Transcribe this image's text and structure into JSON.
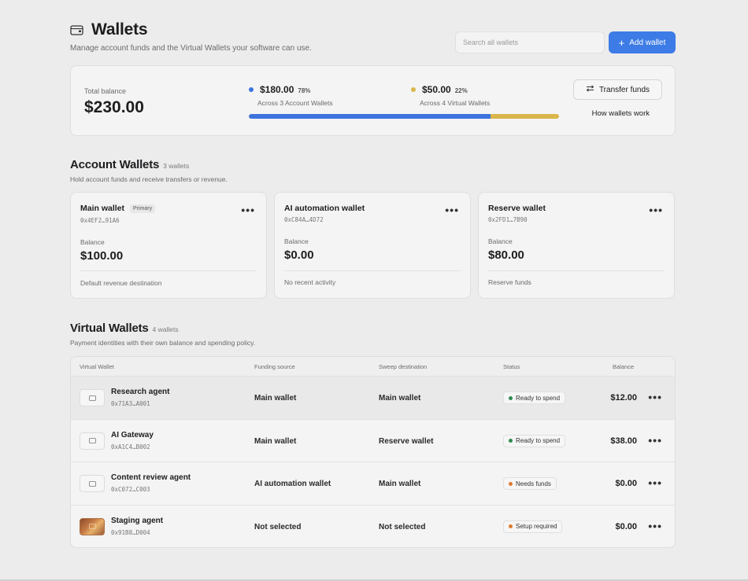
{
  "header": {
    "title": "Wallets",
    "subtitle": "Manage account funds and the Virtual Wallets your software can use.",
    "search_placeholder": "Search all wallets",
    "add_label": "Add wallet",
    "wallet_icon": "wallet-icon"
  },
  "balance": {
    "total_label": "Total balance",
    "total_value": "$230.00",
    "account": {
      "amount": "$180.00",
      "pct": "78%",
      "across": "Across 3 Account Wallets",
      "color": "#3d74de",
      "fraction": 0.78
    },
    "virtual": {
      "amount": "$50.00",
      "pct": "22%",
      "across": "Across 4 Virtual Wallets",
      "color": "#d9b64a",
      "fraction": 0.22
    },
    "transfer_label": "Transfer funds",
    "how_label": "How wallets work"
  },
  "account_wallets": {
    "title": "Account Wallets",
    "count": "3 wallets",
    "subtitle": "Hold account funds and receive transfers or revenue.",
    "balance_label": "Balance",
    "items": [
      {
        "name": "Main wallet",
        "badge": "Primary",
        "addr": "0x4EF2…91A6",
        "balance": "$100.00",
        "footer": "Default revenue destination"
      },
      {
        "name": "AI automation wallet",
        "badge": "",
        "addr": "0xC84A…4D72",
        "balance": "$0.00",
        "footer": "No recent activity"
      },
      {
        "name": "Reserve wallet",
        "badge": "",
        "addr": "0x2FD1…7B90",
        "balance": "$80.00",
        "footer": "Reserve funds"
      }
    ]
  },
  "virtual_wallets": {
    "title": "Virtual Wallets",
    "count": "4 wallets",
    "subtitle": "Payment identities with their own balance and spending policy.",
    "columns": [
      "Virtual Wallet",
      "Funding source",
      "Sweep destination",
      "Status",
      "Balance"
    ],
    "rows": [
      {
        "name": "Research agent",
        "addr": "0x71A3…A001",
        "funding": "Main wallet",
        "sweep": "Main wallet",
        "status": "Ready to spend",
        "status_color": "#2f8a4e",
        "balance": "$12.00",
        "thumb": "card-icon"
      },
      {
        "name": "AI Gateway",
        "addr": "0xA1C4…B002",
        "funding": "Main wallet",
        "sweep": "Reserve wallet",
        "status": "Ready to spend",
        "status_color": "#2f8a4e",
        "balance": "$38.00",
        "thumb": "card-icon"
      },
      {
        "name": "Content review agent",
        "addr": "0xC072…C003",
        "funding": "AI automation wallet",
        "sweep": "Main wallet",
        "status": "Needs funds",
        "status_color": "#e07a2e",
        "balance": "$0.00",
        "thumb": "card-icon"
      },
      {
        "name": "Staging agent",
        "addr": "0x91B8…D004",
        "funding": "Not selected",
        "sweep": "Not selected",
        "status": "Setup required",
        "status_color": "#e07a2e",
        "balance": "$0.00",
        "thumb": "card-image"
      }
    ]
  }
}
